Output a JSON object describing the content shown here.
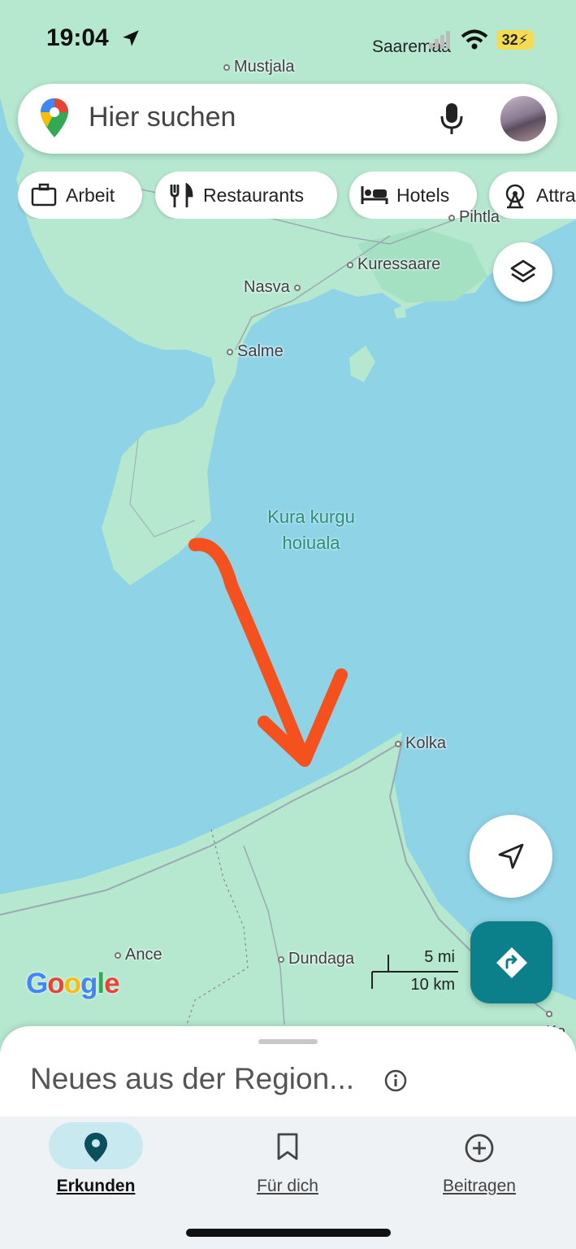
{
  "status_bar": {
    "time": "19:04",
    "carrier": "Saaremaa",
    "battery": "32"
  },
  "search": {
    "placeholder": "Hier suchen"
  },
  "chips": [
    {
      "label": "Arbeit",
      "icon": "briefcase-icon"
    },
    {
      "label": "Restaurants",
      "icon": "fork-knife-icon"
    },
    {
      "label": "Hotels",
      "icon": "bed-icon"
    },
    {
      "label": "Attra",
      "icon": "ferris-wheel-icon"
    }
  ],
  "map": {
    "places": {
      "mustjala": "Mustjala",
      "pihtla": "Pihtla",
      "kuressaare": "Kuressaare",
      "nasva": "Nasva",
      "salme": "Salme",
      "kolka": "Kolka",
      "ance": "Ance",
      "dundaga": "Dundaga",
      "ka": "Ka"
    },
    "water_area": "Kura kurgu hoiuala",
    "google_logo": "Google",
    "scale": {
      "miles": "5 mi",
      "km": "10 km"
    },
    "colors": {
      "water": "#8fd3e6",
      "land": "#b5e8cf",
      "annotation_arrow": "#f4511e",
      "directions_button": "#0b7f8a"
    }
  },
  "sheet": {
    "title": "Neues aus der Region..."
  },
  "bottom_nav": {
    "explore": "Erkunden",
    "for_you": "Für dich",
    "contribute": "Beitragen"
  }
}
